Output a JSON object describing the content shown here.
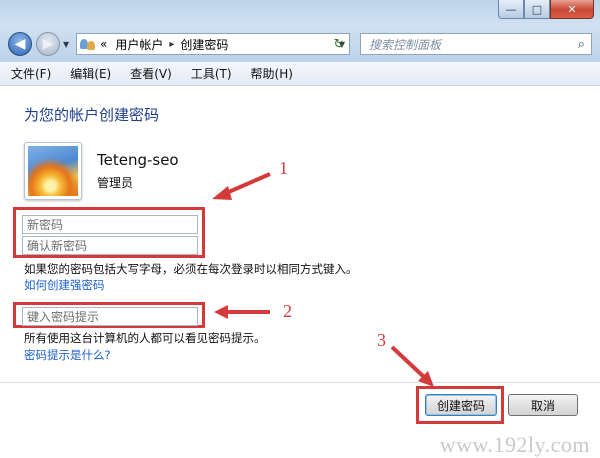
{
  "window": {
    "minimize_glyph": "—",
    "maximize_glyph": "□",
    "close_glyph": "✕"
  },
  "nav": {
    "back_glyph": "◀",
    "forward_glyph": "▶",
    "dropdown_glyph": "▼"
  },
  "address": {
    "prefix": "«",
    "crumbs": [
      "用户帐户",
      "创建密码"
    ],
    "separator": "▸",
    "dropdown_glyph": "▼",
    "refresh_glyph": "↻"
  },
  "search": {
    "placeholder": "搜索控制面板",
    "icon": "⌕"
  },
  "menu": [
    "文件(F)",
    "编辑(E)",
    "查看(V)",
    "工具(T)",
    "帮助(H)"
  ],
  "page": {
    "heading": "为您的帐户创建密码",
    "username": "Teteng-seo",
    "role": "管理员",
    "new_password_placeholder": "新密码",
    "confirm_password_placeholder": "确认新密码",
    "case_note": "如果您的密码包括大写字母，必须在每次登录时以相同方式键入。",
    "strong_password_link": "如何创建强密码",
    "hint_placeholder": "键入密码提示",
    "hint_note": "所有使用这台计算机的人都可以看见密码提示。",
    "hint_link": "密码提示是什么?",
    "create_button": "创建密码",
    "cancel_button": "取消"
  },
  "annotations": {
    "labels": [
      "1",
      "2",
      "3"
    ],
    "color": "#d43a3a"
  },
  "watermark": "www.192ly.com"
}
